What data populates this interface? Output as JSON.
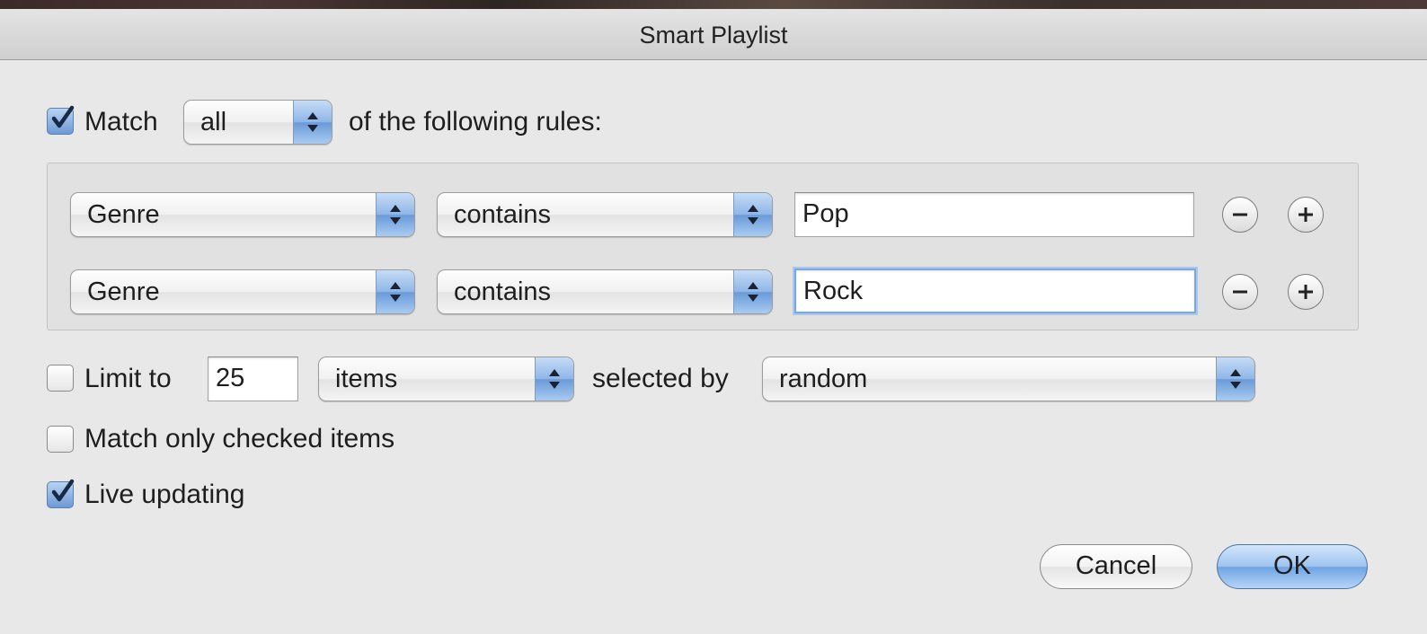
{
  "window": {
    "title": "Smart Playlist"
  },
  "match": {
    "checked": true,
    "label": "Match",
    "mode_value": "all",
    "suffix": "of the following rules:"
  },
  "rules": [
    {
      "field": "Genre",
      "operator": "contains",
      "value": "Pop",
      "focused": false
    },
    {
      "field": "Genre",
      "operator": "contains",
      "value": "Rock",
      "focused": true
    }
  ],
  "limit": {
    "checked": false,
    "label": "Limit to",
    "amount": "25",
    "unit": "items",
    "selected_by_label": "selected by",
    "selected_by_value": "random"
  },
  "options": {
    "match_checked_label": "Match only checked items",
    "match_checked_checked": false,
    "live_updating_label": "Live updating",
    "live_updating_checked": true
  },
  "buttons": {
    "cancel": "Cancel",
    "ok": "OK"
  },
  "icons": {
    "checkmark": "checkmark-icon",
    "popup_arrows": "up-down-arrows-icon",
    "remove_rule": "minus-icon",
    "add_rule": "plus-icon"
  },
  "colors": {
    "accent": "#6c9ad6",
    "focus_ring": "#7aa7e0"
  }
}
